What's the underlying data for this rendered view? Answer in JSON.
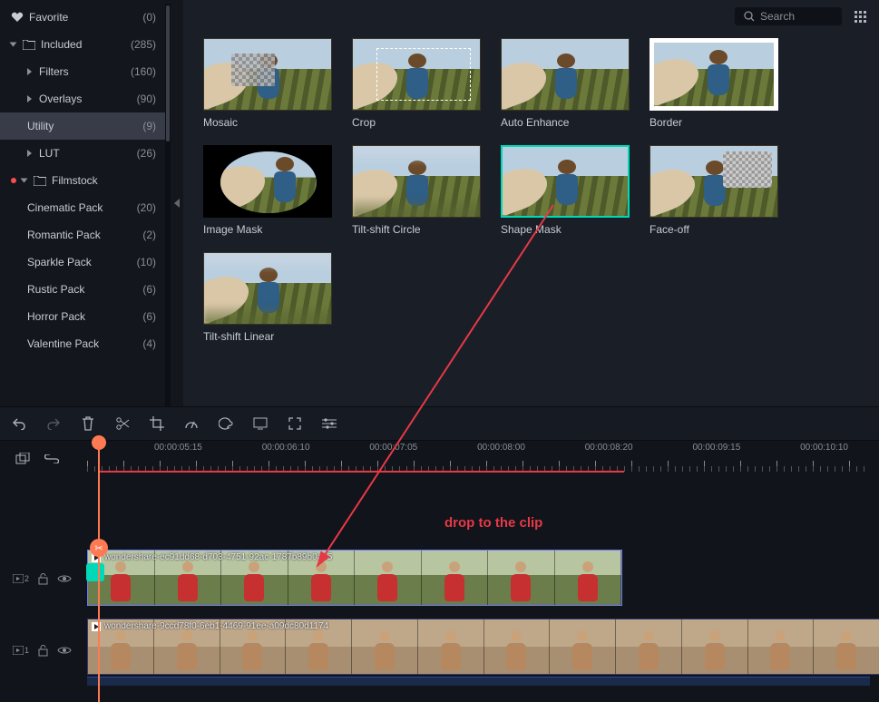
{
  "search": {
    "placeholder": "Search"
  },
  "sidebar": {
    "favorite": {
      "label": "Favorite",
      "count": "(0)"
    },
    "included": {
      "label": "Included",
      "count": "(285)"
    },
    "filters": {
      "label": "Filters",
      "count": "(160)"
    },
    "overlays": {
      "label": "Overlays",
      "count": "(90)"
    },
    "utility": {
      "label": "Utility",
      "count": "(9)"
    },
    "lut": {
      "label": "LUT",
      "count": "(26)"
    },
    "filmstock": {
      "label": "Filmstock"
    },
    "packs": [
      {
        "label": "Cinematic Pack",
        "count": "(20)"
      },
      {
        "label": "Romantic Pack",
        "count": "(2)"
      },
      {
        "label": "Sparkle Pack",
        "count": "(10)"
      },
      {
        "label": "Rustic Pack",
        "count": "(6)"
      },
      {
        "label": "Horror Pack",
        "count": "(6)"
      },
      {
        "label": "Valentine Pack",
        "count": "(4)"
      }
    ]
  },
  "gallery": [
    {
      "label": "Mosaic"
    },
    {
      "label": "Crop"
    },
    {
      "label": "Auto Enhance"
    },
    {
      "label": "Border"
    },
    {
      "label": "Image Mask"
    },
    {
      "label": "Tilt-shift Circle"
    },
    {
      "label": "Shape Mask"
    },
    {
      "label": "Face-off"
    },
    {
      "label": "Tilt-shift Linear"
    }
  ],
  "ruler": {
    "labels": [
      "00:00:05:15",
      "00:00:06:10",
      "00:00:07:05",
      "00:00:08:00",
      "00:00:08:20",
      "00:00:09:15",
      "00:00:10:10"
    ]
  },
  "tracks": {
    "t2": {
      "id": "2"
    },
    "t1": {
      "id": "1"
    }
  },
  "clips": {
    "c1": {
      "name": "wondershare-ec91dd68-d703-4751-92ac-1787b89b0ae5"
    },
    "c2": {
      "name": "wondershare-9ccd78f0-6eb1-4469-91ee-a09dc80d1174"
    }
  },
  "annotation": {
    "text": "drop to the clip"
  }
}
